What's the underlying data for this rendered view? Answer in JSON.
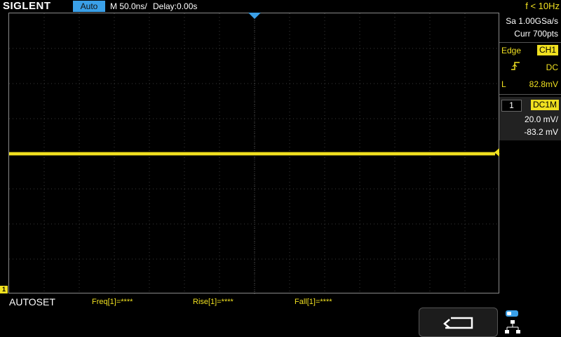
{
  "header": {
    "brand": "SIGLENT",
    "run_status": "Auto",
    "timebase": "M 50.0ns/",
    "delay": "Delay:0.00s",
    "frequency": "f < 10Hz"
  },
  "acquisition": {
    "sample_rate": "Sa 1.00GSa/s",
    "memory": "Curr 700pts"
  },
  "trigger": {
    "type": "Edge",
    "source": "CH1",
    "slope_icon": "rising-edge-icon",
    "coupling": "DC",
    "level_label": "L",
    "level": "82.8mV"
  },
  "channel1": {
    "number": "1",
    "coupling": "DC1M",
    "scale": "20.0 mV/",
    "offset": "-83.2 mV",
    "marker": "1",
    "color": "#f0e020"
  },
  "measurements": {
    "mode": "AUTOSET",
    "freq": "Freq[1]=****",
    "rise": "Rise[1]=****",
    "fall": "Fall[1]=****"
  },
  "softkeys": {
    "return_icon": "return-arrow-icon",
    "network_icon": "network-icon"
  },
  "colors": {
    "accent": "#3aa0e8",
    "trace": "#f0e020",
    "grid": "#8a8a8a"
  }
}
